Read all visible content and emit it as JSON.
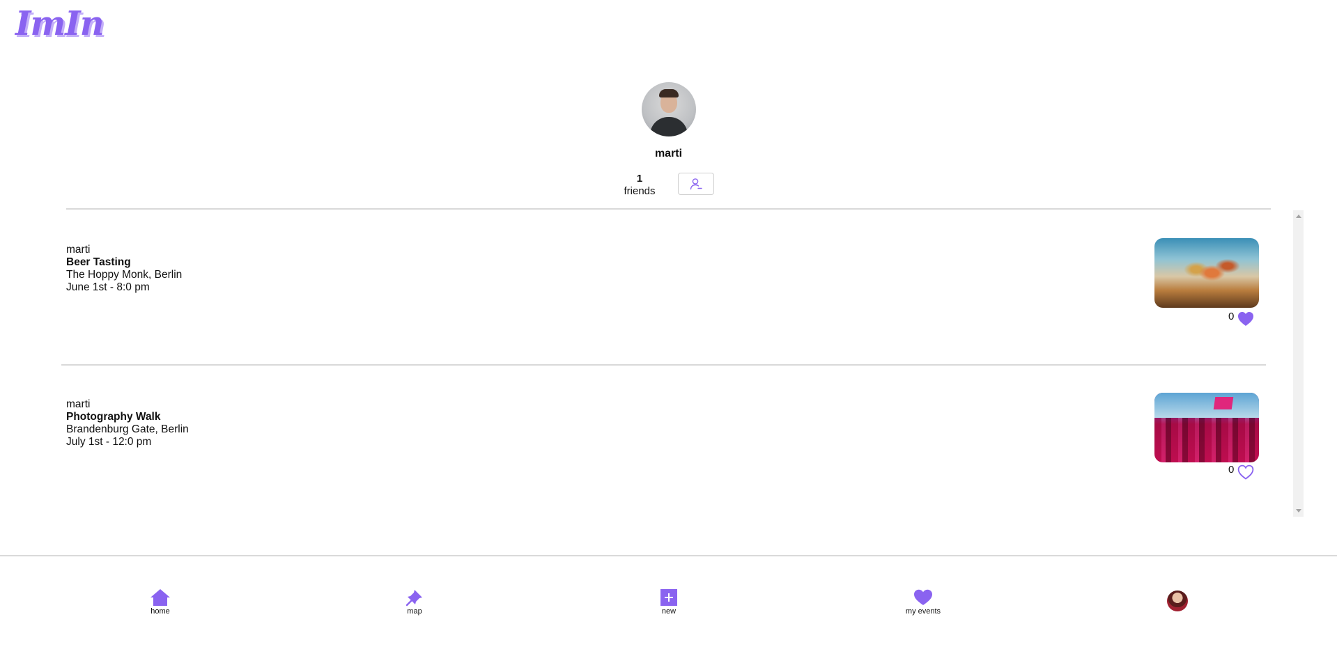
{
  "app": {
    "logo_text": "ImIn",
    "brand_color": "#8a63f0"
  },
  "profile": {
    "name": "marti",
    "friends_count": "1",
    "friends_label": "friends",
    "unfriend_icon": "user-minus-icon"
  },
  "events": [
    {
      "host": "marti",
      "title": "Beer Tasting",
      "location": "The Hoppy Monk, Berlin",
      "datetime": "June 1st - 8:0 pm",
      "likes": "0",
      "liked": true
    },
    {
      "host": "marti",
      "title": "Photography Walk",
      "location": "Brandenburg Gate, Berlin",
      "datetime": "July 1st - 12:0 pm",
      "likes": "0",
      "liked": false
    }
  ],
  "nav": {
    "items": [
      {
        "label": "home",
        "icon": "home-icon"
      },
      {
        "label": "map",
        "icon": "pin-icon"
      },
      {
        "label": "new",
        "icon": "plus-square-icon"
      },
      {
        "label": "my events",
        "icon": "heart-icon"
      },
      {
        "label": "",
        "icon": "avatar"
      }
    ]
  }
}
